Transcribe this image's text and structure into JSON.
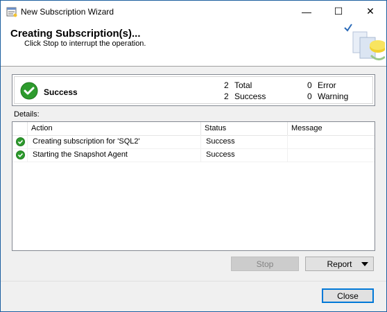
{
  "window": {
    "title": "New Subscription Wizard",
    "minimize_glyph": "—",
    "maximize_glyph": "☐",
    "close_glyph": "✕"
  },
  "header": {
    "title": "Creating Subscription(s)...",
    "subtitle": "Click Stop to interrupt the operation."
  },
  "summary": {
    "status": "Success",
    "total_count": "2",
    "total_label": "Total",
    "success_count": "2",
    "success_label": "Success",
    "error_count": "0",
    "error_label": "Error",
    "warning_count": "0",
    "warning_label": "Warning",
    "status_color": "#2e9b2e"
  },
  "details": {
    "label": "Details:",
    "columns": [
      "Action",
      "Status",
      "Message"
    ],
    "rows": [
      {
        "action": "Creating subscription for 'SQL2'",
        "status": "Success",
        "message": ""
      },
      {
        "action": "Starting the Snapshot Agent",
        "status": "Success",
        "message": ""
      }
    ]
  },
  "buttons": {
    "stop": "Stop",
    "report": "Report",
    "close": "Close"
  }
}
